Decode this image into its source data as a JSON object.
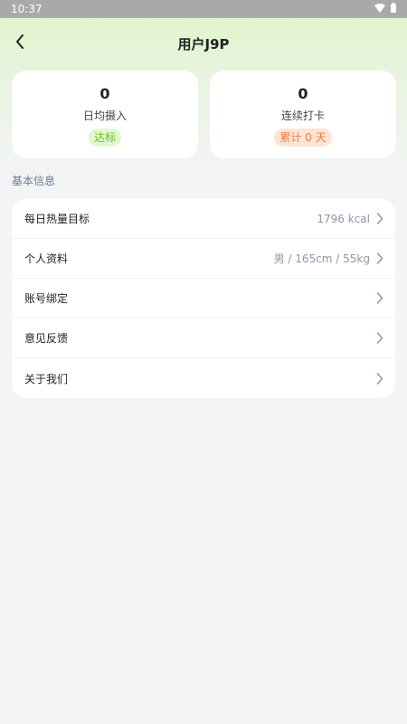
{
  "status_bar": {
    "time": "10:37"
  },
  "header": {
    "title": "用户J9P"
  },
  "stats": {
    "daily_intake": {
      "value": "0",
      "label": "日均摄入",
      "badge": "达标"
    },
    "streak": {
      "value": "0",
      "label": "连续打卡",
      "badge": "累计 0 天"
    }
  },
  "section": {
    "title": "基本信息"
  },
  "list": {
    "items": [
      {
        "label": "每日热量目标",
        "value": "1796 kcal"
      },
      {
        "label": "个人资料",
        "value": "男 / 165cm / 55kg"
      },
      {
        "label": "账号绑定",
        "value": ""
      },
      {
        "label": "意见反馈",
        "value": ""
      },
      {
        "label": "关于我们",
        "value": ""
      }
    ]
  },
  "colors": {
    "accent_green": "#6bbd2a",
    "accent_orange": "#f07a3a",
    "header_gradient": "#dcf6c4"
  }
}
